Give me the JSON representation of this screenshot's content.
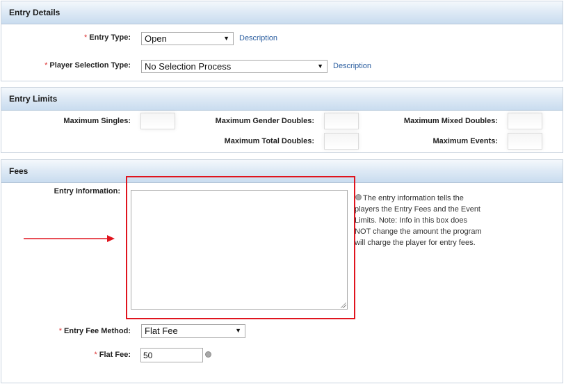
{
  "entry_details": {
    "title": "Entry Details",
    "entry_type_label": "Entry Type:",
    "entry_type_value": "Open",
    "player_selection_label": "Player Selection Type:",
    "player_selection_value": "No Selection Process",
    "description_link": "Description"
  },
  "entry_limits": {
    "title": "Entry Limits",
    "max_singles_label": "Maximum Singles:",
    "max_gender_doubles_label": "Maximum Gender Doubles:",
    "max_mixed_doubles_label": "Maximum Mixed Doubles:",
    "max_total_doubles_label": "Maximum Total Doubles:",
    "max_events_label": "Maximum Events:"
  },
  "fees": {
    "title": "Fees",
    "entry_information_label": "Entry Information:",
    "entry_information_help": "The entry information tells the players the Entry Fees and the Event Limits. Note: Info in this box does NOT change the amount the program will charge the player for entry fees.",
    "entry_fee_method_label": "Entry Fee Method:",
    "entry_fee_method_value": "Flat Fee",
    "flat_fee_label": "Flat Fee:",
    "flat_fee_value": "50"
  },
  "annotation": {
    "highlight_color": "#e0141e",
    "arrow_color": "#e0141e"
  },
  "icons": {
    "dropdown": "chevron-down-icon",
    "help": "help-icon"
  },
  "required_marker": "*"
}
